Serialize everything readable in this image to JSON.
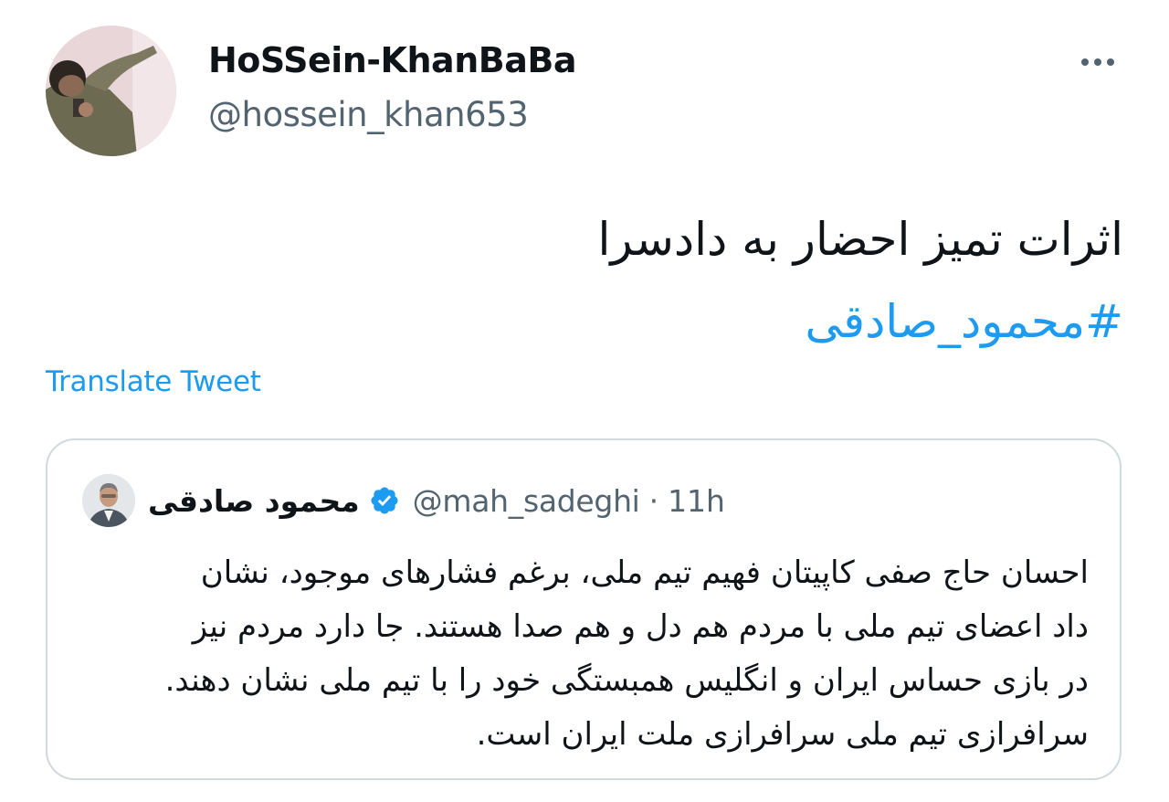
{
  "author": {
    "display_name": "HoSSein-KhanBaBa",
    "handle": "@hossein_khan653",
    "avatar": "profile-photo"
  },
  "more_icon": "more-horizontal-icon",
  "tweet": {
    "text": "اثرات تمیز احضار به دادسرا",
    "hashtag": "#محمود_صادقی"
  },
  "translate_label": "Translate Tweet",
  "quoted_tweet": {
    "display_name": "محمود صادقی",
    "verified_icon": "verified-badge-icon",
    "handle": "@mah_sadeghi",
    "separator": "·",
    "time": "11h",
    "lines": [
      "احسان حاج صفی کاپیتان فهیم تیم ملی، برغم فشارهای موجود، نشان",
      "داد اعضای تیم ملی با مردم هم دل و هم صدا هستند. جا دارد مردم نیز",
      "در بازی حساس ایران و انگلیس همبستگی خود را با تیم ملی نشان دهند.",
      "سرافرازی تیم ملی سرافرازی ملت ایران است."
    ]
  },
  "colors": {
    "link": "#1d9bf0",
    "secondary_text": "#536471",
    "primary_text": "#0f1419",
    "border": "#cfd9de"
  }
}
